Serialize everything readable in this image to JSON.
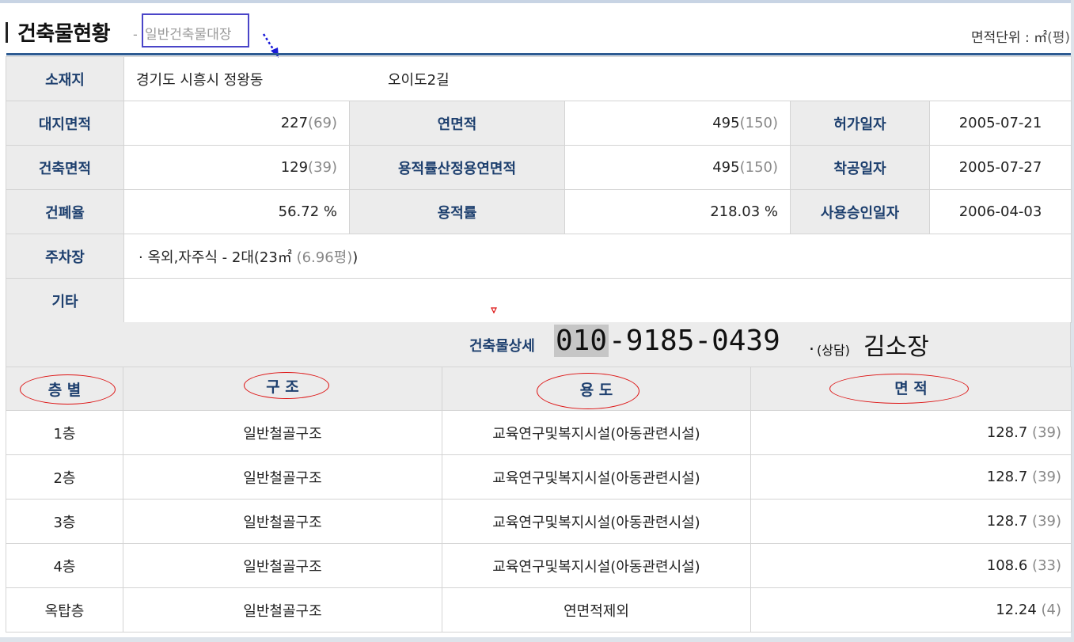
{
  "header": {
    "title": "건축물현황",
    "subtitle_sep": "-",
    "subtitle": "일반건축물대장",
    "unit_label": "면적단위 : ㎡",
    "unit_paren": "(평)"
  },
  "info": {
    "location_label": "소재지",
    "location_value": "경기도 시흥시 정왕동",
    "location_road": "오이도2길",
    "site_area_label": "대지면적",
    "site_area_value": "227",
    "site_area_pyeong": "(69)",
    "total_floor_area_label": "연면적",
    "total_floor_area_value": "495",
    "total_floor_area_pyeong": "(150)",
    "permit_date_label": "허가일자",
    "permit_date_value": "2005-07-21",
    "building_area_label": "건축면적",
    "building_area_value": "129",
    "building_area_pyeong": "(39)",
    "far_area_label": "용적률산정용연면적",
    "far_area_value": "495",
    "far_area_pyeong": "(150)",
    "start_date_label": "착공일자",
    "start_date_value": "2005-07-27",
    "bcr_label": "건폐율",
    "bcr_value": "56.72 %",
    "far_label": "용적률",
    "far_value": "218.03 %",
    "approval_date_label": "사용승인일자",
    "approval_date_value": "2006-04-03",
    "parking_label": "주차장",
    "parking_value": "· 옥외,자주식 - 2대(23㎡",
    "parking_pyeong": "(6.96평)",
    "parking_close": ")",
    "etc_label": "기타",
    "etc_value": ""
  },
  "detail": {
    "label": "건축물상세",
    "phone_prefix": "010",
    "phone_rest": "-9185-0439",
    "consult_dot": ".",
    "consult": "(상담)",
    "consult_name": "김소장"
  },
  "floors": {
    "headers": [
      "층 별",
      "구 조",
      "용 도",
      "면 적"
    ],
    "rows": [
      {
        "floor": "1층",
        "structure": "일반철골구조",
        "use": "교육연구및복지시설(아동관련시설)",
        "area": "128.7",
        "pyeong": "(39)"
      },
      {
        "floor": "2층",
        "structure": "일반철골구조",
        "use": "교육연구및복지시설(아동관련시설)",
        "area": "128.7",
        "pyeong": "(39)"
      },
      {
        "floor": "3층",
        "structure": "일반철골구조",
        "use": "교육연구및복지시설(아동관련시설)",
        "area": "128.7",
        "pyeong": "(39)"
      },
      {
        "floor": "4층",
        "structure": "일반철골구조",
        "use": "교육연구및복지시설(아동관련시설)",
        "area": "108.6",
        "pyeong": "(33)"
      },
      {
        "floor": "옥탑층",
        "structure": "일반철골구조",
        "use": "연면적제외",
        "area": "12.24",
        "pyeong": "(4)"
      }
    ]
  },
  "colors": {
    "accent_blue": "#2e5b92",
    "label_text": "#1d3f6e",
    "annotation_red": "#dd1111",
    "annotation_box": "#4a45c8"
  }
}
